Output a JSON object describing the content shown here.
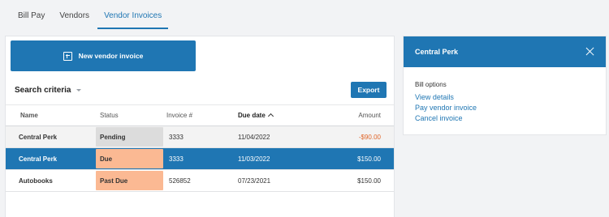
{
  "tabs": [
    {
      "label": "Bill Pay",
      "active": false
    },
    {
      "label": "Vendors",
      "active": false
    },
    {
      "label": "Vendor Invoices",
      "active": true
    }
  ],
  "toolbar": {
    "new_invoice_label": "New vendor invoice",
    "search_criteria_label": "Search criteria",
    "export_label": "Export"
  },
  "table": {
    "headers": {
      "name": "Name",
      "status": "Status",
      "invoice": "Invoice #",
      "due_date": "Due date",
      "amount": "Amount"
    },
    "sort": {
      "column": "due_date",
      "direction": "ascending"
    },
    "rows": [
      {
        "name": "Central Perk",
        "status": "Pending",
        "status_color": "#dcdcdc",
        "invoice": "3333",
        "due_date": "11/04/2022",
        "amount": "-$90.00",
        "selected": false
      },
      {
        "name": "Central Perk",
        "status": "Due",
        "status_color": "#fbb993",
        "invoice": "3333",
        "due_date": "11/03/2022",
        "amount": "$150.00",
        "selected": true
      },
      {
        "name": "Autobooks",
        "status": "Past Due",
        "status_color": "#fbb993",
        "invoice": "526852",
        "due_date": "07/23/2021",
        "amount": "$150.00",
        "selected": false
      }
    ]
  },
  "detail_panel": {
    "title": "Central Perk",
    "section_label": "Bill options",
    "links": [
      "View details",
      "Pay vendor invoice",
      "Cancel invoice"
    ]
  },
  "colors": {
    "primary": "#1f76b3",
    "negative_amount": "#e0662a",
    "badge_pending": "#dcdcdc",
    "badge_due": "#fbb993"
  }
}
